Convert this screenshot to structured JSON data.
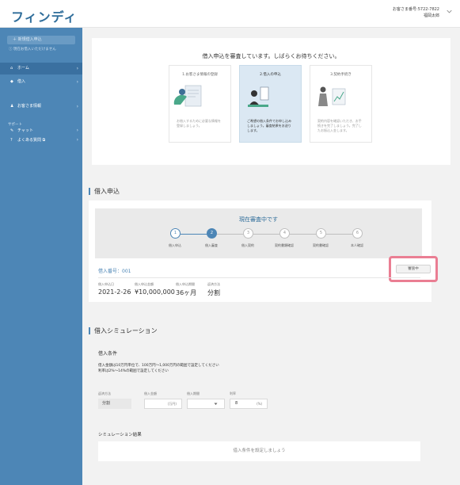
{
  "header": {
    "logo": "フィンディ",
    "customer_no": "お客さま番号:5722-7822",
    "user_name": "福岡太郎"
  },
  "sidebar": {
    "new_app_label": "新規借入申込",
    "new_app_note": "ⓘ 現在お借入いただけません",
    "items": [
      {
        "label": "ホーム",
        "icon": "home-icon",
        "icon_glyph": "⌂"
      },
      {
        "label": "借入",
        "icon": "yen-icon",
        "icon_glyph": "◆"
      },
      {
        "label": "お客さま情報",
        "icon": "user-icon",
        "icon_glyph": "♟"
      }
    ],
    "support_label": "サポート",
    "support_items": [
      {
        "label": "チャット",
        "icon": "chat-icon",
        "icon_glyph": "✎"
      },
      {
        "label": "よくある質問 ⧉",
        "icon": "help-icon",
        "icon_glyph": "?"
      }
    ]
  },
  "review": {
    "title": "借入申込を審査しています。しばらくお待ちください。",
    "steps": [
      {
        "title": "1.お客さま情報の登録",
        "desc": "お借入するために必要な情報を登録しましょう。"
      },
      {
        "title": "2.借入の申込",
        "desc": "ご希望の借入条件でお申し込みしましょう。審査結果をお送りします。"
      },
      {
        "title": "3.契約手続き",
        "desc": "契約内容を確認いただき、お手続きを完了しましょう。完了したお振込入金します。"
      }
    ]
  },
  "application": {
    "section_title": "借入申込",
    "progress_title": "現在審査中です",
    "progress_steps": [
      "借入申込",
      "借入審査",
      "借入契約",
      "契約書類確認",
      "契約書確認",
      "本人確認"
    ],
    "loan_number": "借入番号：001",
    "status": "審査中",
    "info": [
      {
        "label": "借入申込日",
        "value": "2021-2-26"
      },
      {
        "label": "借入申込金額",
        "value": "¥10,000,000"
      },
      {
        "label": "借入申込期間",
        "value": "36ヶ月"
      },
      {
        "label": "返済方法",
        "value": "分割"
      }
    ]
  },
  "simulation": {
    "section_title": "借入シミュレーション",
    "conditions_title": "借入条件",
    "note_line1": "借入金額は10万円単位で、100万円〜1,000万円の範囲で設定してください",
    "note_line2": "利率は2%〜14%の範囲で設定してください",
    "fields": {
      "method_label": "返済方法",
      "method_value": "分割",
      "amount_label": "借入金額",
      "amount_unit": "(万円)",
      "period_label": "借入期間",
      "rate_label": "利率",
      "rate_value": "8",
      "rate_unit": "(%)"
    },
    "result_title": "シミュレーション結果",
    "result_placeholder": "借入条件を設定しましょう"
  },
  "colors": {
    "sidebar": "#4d86b6",
    "accent": "#2f6d9a",
    "highlight": "#ea7e93"
  }
}
